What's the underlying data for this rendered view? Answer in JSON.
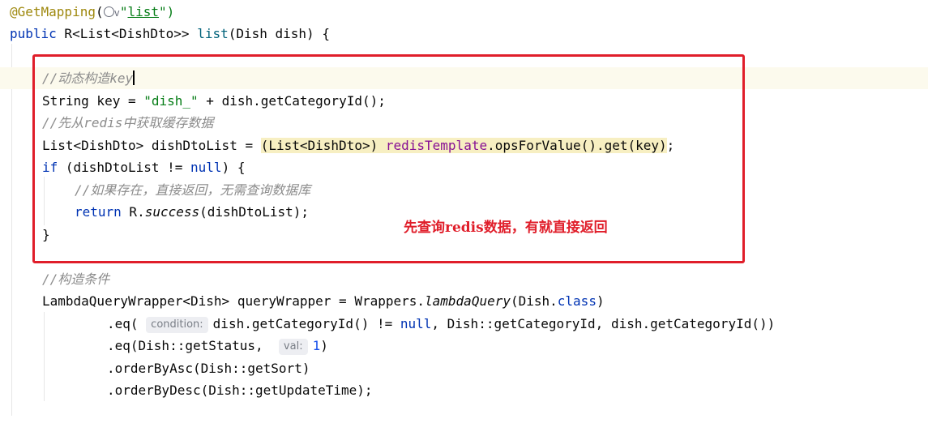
{
  "code": {
    "l1_annotation": "@GetMapping",
    "l1_paren": "(",
    "l1_globe_chevron": "v",
    "l1_quote_open": "\"",
    "l1_path": "list",
    "l1_close": "\")",
    "l2_kw": "public",
    "l2_rest_a": " R<List<DishDto>> ",
    "l2_method": "list",
    "l2_rest_b": "(Dish dish) {",
    "l3_comment": "//动态构造key",
    "l4_a": "String key = ",
    "l4_str": "\"dish_\"",
    "l4_b": " + dish.getCategoryId();",
    "l5_comment": "//先从redis中获取缓存数据",
    "l6_a": "List<DishDto> dishDtoList = ",
    "l6_cast": "(List<DishDto>)",
    "l6_space": " ",
    "l6_field": "redisTemplate",
    "l6_b": ".opsForValue().get(key)",
    "l6_c": ";",
    "l7_kw": "if",
    "l7_a": " (dishDtoList != ",
    "l7_null": "null",
    "l7_b": ") {",
    "l8_comment": "//如果存在，直接返回，无需查询数据库",
    "l9_kw": "return",
    "l9_a": " R.",
    "l9_ital": "success",
    "l9_b": "(dishDtoList);",
    "l10": "}",
    "l11_comment": "//构造条件",
    "l12_a": "LambdaQueryWrapper<Dish> queryWrapper = Wrappers.",
    "l12_ital": "lambdaQuery",
    "l12_b": "(Dish.",
    "l12_kw": "class",
    "l12_c": ")",
    "l13_a": ".eq( ",
    "l13_hint": "condition:",
    "l13_b": "dish.getCategoryId() != ",
    "l13_null": "null",
    "l13_c": ", Dish::getCategoryId, dish.getCategoryId())",
    "l14_a": ".eq(Dish::getStatus,  ",
    "l14_hint": "val:",
    "l14_num": "1",
    "l14_b": ")",
    "l15": ".orderByAsc(Dish::getSort)",
    "l16": ".orderByDesc(Dish::getUpdateTime);"
  },
  "annotation_note": "先查询redis数据，有就直接返回",
  "colors": {
    "keyword": "#0033b3",
    "annotation": "#9e880d",
    "string": "#067d17",
    "field": "#871094",
    "comment": "#8c8c8c",
    "number": "#1750eb",
    "red_box": "#e01e2a",
    "current_line": "#fcfaed"
  }
}
